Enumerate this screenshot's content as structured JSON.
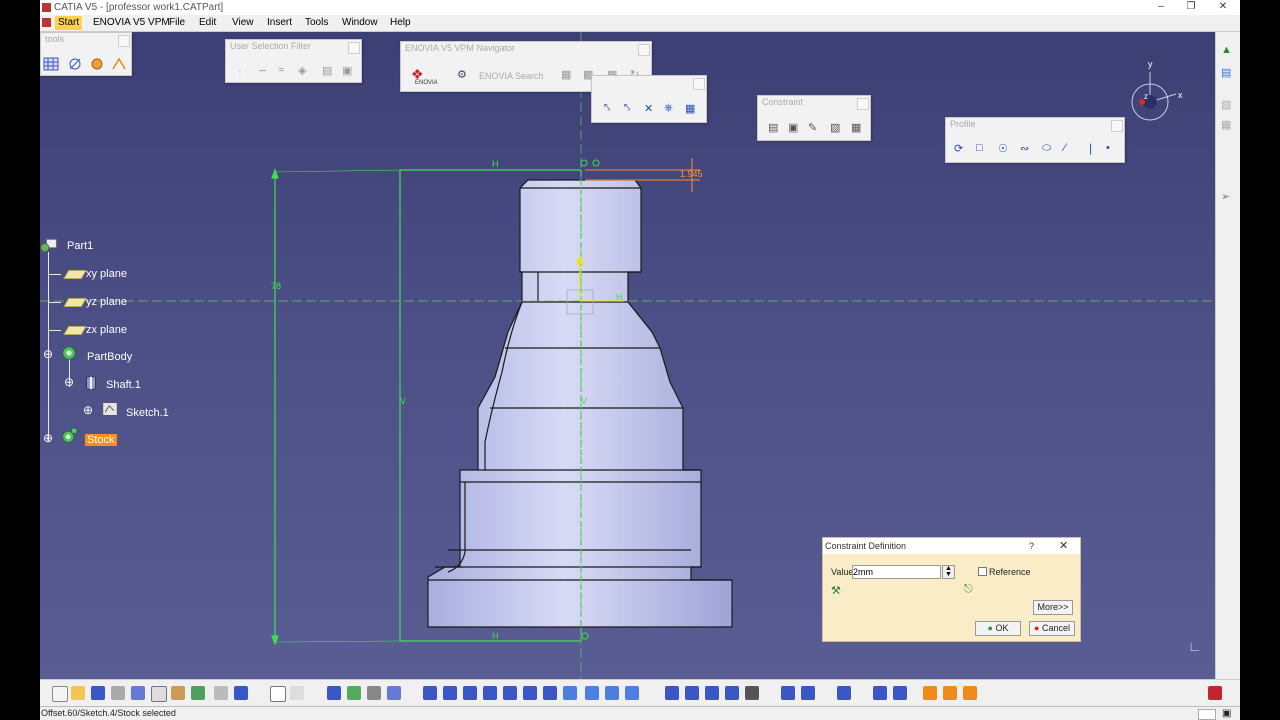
{
  "window": {
    "title": "CATIA V5 - [professor work1.CATPart]"
  },
  "menu": [
    "Start",
    "ENOVIA V5 VPM",
    "File",
    "Edit",
    "View",
    "Insert",
    "Tools",
    "Window",
    "Help"
  ],
  "panels": {
    "tools": {
      "title": "tools"
    },
    "user_selection_filter": {
      "title": "User Selection Filter"
    },
    "vpm_navigator": {
      "title": "ENOVIA V5 VPM Navigator",
      "logo_label": "ENOVIA",
      "search_label": "ENOVIA Search"
    },
    "constraint": {
      "title": "Constraint"
    },
    "profile": {
      "title": "Profile"
    }
  },
  "tree": {
    "root": "Part1",
    "items": [
      "xy plane",
      "yz plane",
      "zx plane",
      "PartBody",
      "Shaft.1",
      "Sketch.1",
      "Stock"
    ],
    "selected": "Stock"
  },
  "dimensions": {
    "top_offset": "1.945",
    "height": "78"
  },
  "compass": {
    "y_label": "y",
    "x_label": "x",
    "z_label": "z"
  },
  "dialog": {
    "title": "Constraint Definition",
    "help": "?",
    "value_label": "Value",
    "value": "2mm",
    "reference_label": "Reference",
    "more_label": "More>>",
    "ok_label": "OK",
    "cancel_label": "Cancel"
  },
  "status_text": "Offset.60/Sketch.4/Stock selected",
  "colors": {
    "viewport": "#4c4f86",
    "sketch_green": "#3fe04a",
    "selection": "#ff8c1a",
    "dimension": "#ff8c2a"
  }
}
